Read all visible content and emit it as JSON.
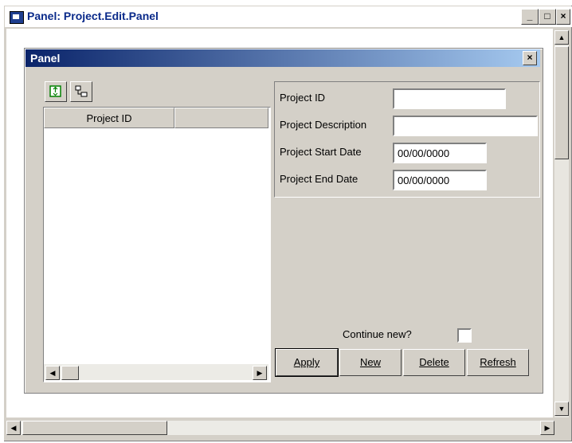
{
  "outer_window": {
    "title": "Panel: Project.Edit.Panel",
    "minimize": "_",
    "maximize": "□",
    "close": "×"
  },
  "panel": {
    "title": "Panel",
    "close": "×"
  },
  "toolbar": {
    "refresh_icon": "refresh-icon",
    "tree_icon": "tree-icon"
  },
  "list": {
    "columns": [
      "Project ID",
      ""
    ],
    "rows": []
  },
  "form": {
    "project_id_label": "Project ID",
    "project_id_value": "",
    "description_label": "Project Description",
    "description_value": "",
    "start_label": "Project Start Date",
    "start_value": "00/00/0000",
    "end_label": "Project End Date",
    "end_value": "00/00/0000"
  },
  "continue_new": {
    "label": "Continue new?",
    "checked": false
  },
  "buttons": {
    "apply": "Apply",
    "new": "New",
    "delete": "Delete",
    "refresh": "Refresh"
  }
}
